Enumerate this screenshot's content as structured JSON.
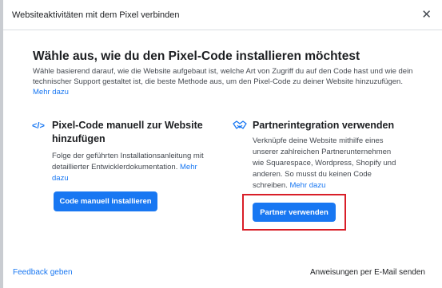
{
  "dialog": {
    "header_title": "Websiteaktivitäten mit dem Pixel verbinden",
    "close_glyph": "✕"
  },
  "main": {
    "title": "Wähle aus, wie du den Pixel-Code installieren möchtest",
    "description": "Wähle basierend darauf, wie die Website aufgebaut ist, welche Art von Zugriff du auf den Code hast und wie dein technischer Support gestaltet ist, die beste Methode aus, um den Pixel-Code zu deiner Website hinzuzufügen.",
    "learn_more": "Mehr dazu"
  },
  "options": {
    "manual": {
      "icon": "code-icon",
      "icon_glyph": "</>",
      "title": "Pixel-Code manuell zur Website hinzufügen",
      "description": "Folge der geführten Installationsanleitung mit detaillierter Entwicklerdokumentation.",
      "learn_more": "Mehr dazu",
      "button_label": "Code manuell installieren"
    },
    "partner": {
      "icon": "handshake-icon",
      "title": "Partnerintegration verwenden",
      "description": "Verknüpfe deine Website mithilfe eines unserer zahlreichen Partnerunternehmen wie Squarespace, Wordpress, Shopify und anderen. So musst du keinen Code schreiben.",
      "learn_more": "Mehr dazu",
      "button_label": "Partner verwenden"
    }
  },
  "footer": {
    "feedback_label": "Feedback geben",
    "email_instructions_label": "Anweisungen per E-Mail senden"
  },
  "colors": {
    "accent": "#1877f2",
    "highlight_border": "#d91e28"
  }
}
